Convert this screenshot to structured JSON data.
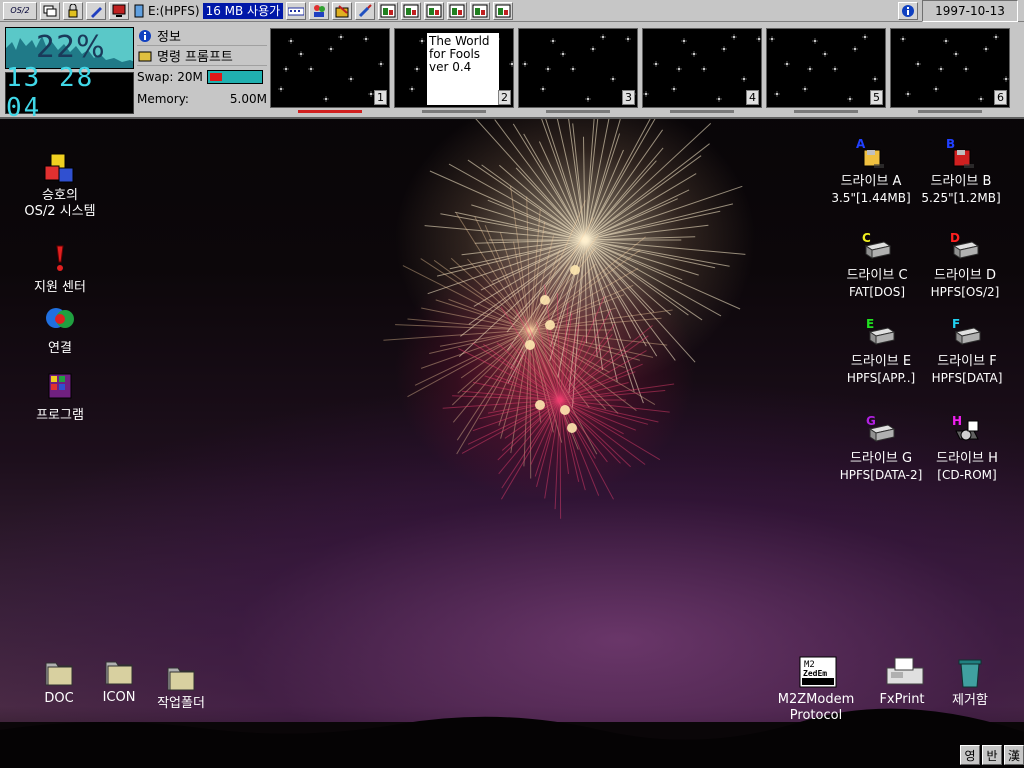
{
  "topbar": {
    "os2_label": "OS/2",
    "drive_label": "E:(HPFS)",
    "drive_free": "16 MB 사용가",
    "date": "1997-10-13"
  },
  "monitor": {
    "cpu_percent": "22%",
    "clock": "13 28 04",
    "swap_label": "Swap: 20M",
    "memory_label": "Memory:",
    "memory_value": "5.00M"
  },
  "menu": {
    "info_label": "정보",
    "prompt_label": "명령 프롬프트"
  },
  "virtual_desktops": [
    {
      "num": "1"
    },
    {
      "num": "2",
      "window_text": "The World for Fools ver 0.4"
    },
    {
      "num": "3"
    },
    {
      "num": "4"
    },
    {
      "num": "5"
    },
    {
      "num": "6"
    }
  ],
  "left_icons": [
    {
      "line1": "승호의",
      "line2": "OS/2 시스템"
    },
    {
      "line1": "지원 센터"
    },
    {
      "line1": "연결"
    },
    {
      "line1": "프로그램"
    }
  ],
  "drives": [
    {
      "letter": "A",
      "line1": "드라이브 A",
      "line2": "3.5\"[1.44MB]",
      "color": "#2040ff"
    },
    {
      "letter": "B",
      "line1": "드라이브 B",
      "line2": "5.25\"[1.2MB]",
      "color": "#2040ff"
    },
    {
      "letter": "C",
      "line1": "드라이브 C",
      "line2": "FAT[DOS]",
      "color": "#f0f020"
    },
    {
      "letter": "D",
      "line1": "드라이브 D",
      "line2": "HPFS[OS/2]",
      "color": "#ff2020"
    },
    {
      "letter": "E",
      "line1": "드라이브 E",
      "line2": "HPFS[APP..]",
      "color": "#20e020"
    },
    {
      "letter": "F",
      "line1": "드라이브 F",
      "line2": "HPFS[DATA]",
      "color": "#20d0f0"
    },
    {
      "letter": "G",
      "line1": "드라이브 G",
      "line2": "HPFS[DATA-2]",
      "color": "#b020e0"
    },
    {
      "letter": "H",
      "line1": "드라이브 H",
      "line2": "[CD-ROM]",
      "color": "#f020f0"
    }
  ],
  "bottom_icons": {
    "doc": "DOC",
    "icon": "ICON",
    "work": "작업폴더",
    "m2z_line1": "M2ZModem",
    "m2z_line2": "Protocol",
    "m2z_badge_top": "M2",
    "m2z_badge_bottom": "ZedEm",
    "fxprint": "FxPrint",
    "trash": "제거함"
  },
  "ime": {
    "a": "영",
    "b": "반",
    "c": "漢"
  }
}
